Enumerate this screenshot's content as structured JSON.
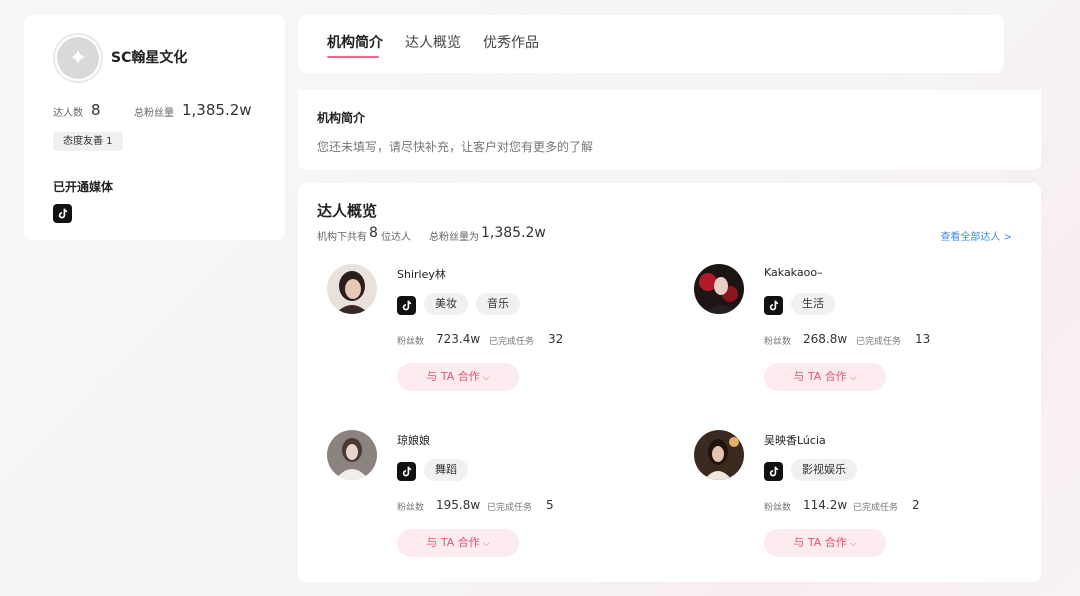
{
  "profile": {
    "org_name": "SC翰星文化",
    "creators_label": "达人数",
    "creators_count": "8",
    "fans_label": "总粉丝量",
    "fans_total": "1,385.2w",
    "badge": "态度友善 1",
    "media_title": "已开通媒体",
    "media_icon": "tiktok-icon"
  },
  "tabs": [
    {
      "label": "机构简介",
      "active": true
    },
    {
      "label": "达人概览",
      "active": false
    },
    {
      "label": "优秀作品",
      "active": false
    }
  ],
  "intro": {
    "title": "机构简介",
    "text": "您还未填写，请尽快补充，让客户对您有更多的了解"
  },
  "overview": {
    "title": "达人概览",
    "sub_prefix": "机构下共有",
    "creator_count": "8",
    "sub_suffix": "位达人",
    "fans_prefix": "总粉丝量为",
    "fans_total": "1,385.2w",
    "view_all": "查看全部达人 >",
    "fans_label": "粉丝数",
    "tasks_label": "已完成任务",
    "collab_label": "与 TA 合作",
    "creators": [
      {
        "name": "Shirley林",
        "tags": [
          "美妆",
          "音乐"
        ],
        "fans": "723.4w",
        "tasks": "32"
      },
      {
        "name": "Kakakaoo–",
        "tags": [
          "生活"
        ],
        "fans": "268.8w",
        "tasks": "13"
      },
      {
        "name": "琼娘娘",
        "tags": [
          "舞蹈"
        ],
        "fans": "195.8w",
        "tasks": "5"
      },
      {
        "name": "吴映香Lúcia",
        "tags": [
          "影视娱乐"
        ],
        "fans": "114.2w",
        "tasks": "2"
      }
    ]
  },
  "colors": {
    "accent": "#f2668b",
    "link": "#3a8dde",
    "collab_bg": "#fcecef",
    "collab_text": "#e5537a"
  }
}
